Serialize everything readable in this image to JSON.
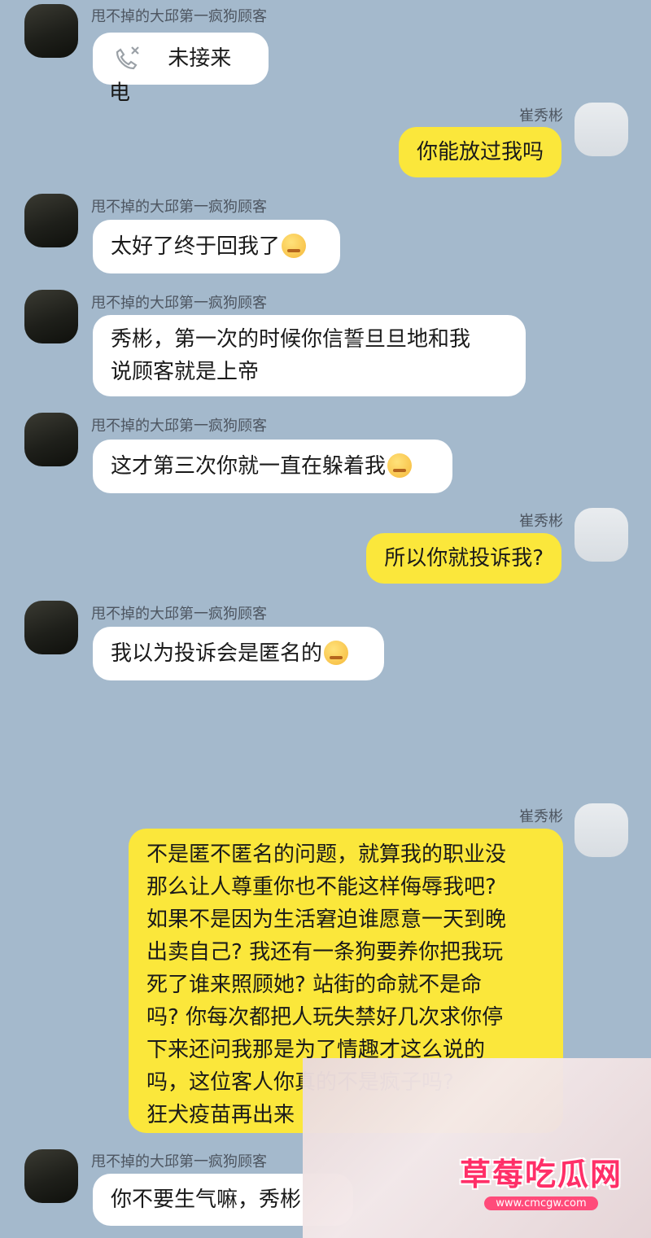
{
  "contacts": {
    "other_name": "甩不掉的大邱第一疯狗顾客",
    "self_name": "崔秀彬"
  },
  "messages": [
    {
      "text": "未接来电",
      "icon": "missed-call-icon"
    },
    {
      "text": "你能放过我吗"
    },
    {
      "text": "太好了终于回我了",
      "emoji": "crying-face-emoji"
    },
    {
      "lines": [
        "秀彬，第一次的时候你信誓旦旦地和我",
        "说顾客就是上帝"
      ]
    },
    {
      "text": "这才第三次你就一直在躲着我",
      "emoji": "pleading-face-emoji"
    },
    {
      "text": "所以你就投诉我?"
    },
    {
      "text": "我以为投诉会是匿名的",
      "emoji": "persevering-face-emoji"
    },
    {
      "lines": [
        "不是匿不匿名的问题，就算我的职业没",
        "那么让人尊重你也不能这样侮辱我吧?",
        "如果不是因为生活窘迫谁愿意一天到晚",
        "出卖自己? 我还有一条狗要养你把我玩",
        "死了谁来照顾她? 站街的命就不是命",
        "吗? 你每次都把人玩失禁好几次求你停",
        "下来还问我那是为了情趣才这么说的",
        "吗，这位客人你真的不是疯子吗?",
        "狂犬疫苗再出来"
      ]
    },
    {
      "text": "你不要生气嘛，秀彬"
    }
  ],
  "watermark": {
    "title": "草莓吃瓜网",
    "url": "www.cmcgw.com"
  },
  "colors": {
    "background": "#a4b9cc",
    "incoming_bubble": "#ffffff",
    "outgoing_bubble": "#fbe73b"
  }
}
